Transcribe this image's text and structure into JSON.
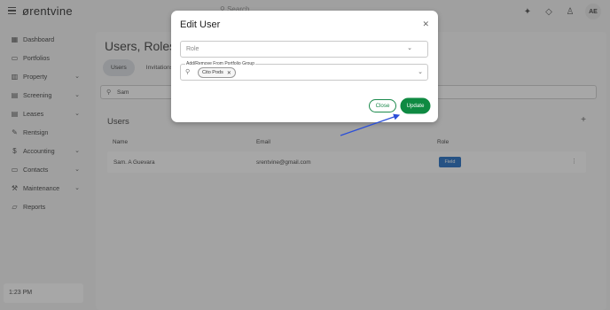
{
  "app": {
    "logo": "ørentvine",
    "search_placeholder": "Search ..."
  },
  "topbar": {
    "avatar_initials": "AE",
    "icons": [
      "sparkle-icon",
      "bell-icon",
      "person-icon"
    ]
  },
  "sidebar": {
    "items": [
      {
        "label": "Dashboard",
        "icon": "grid-icon",
        "has_chevron": false
      },
      {
        "label": "Portfolios",
        "icon": "folder-icon",
        "has_chevron": false
      },
      {
        "label": "Property",
        "icon": "building-icon",
        "has_chevron": true
      },
      {
        "label": "Screening",
        "icon": "screening-icon",
        "has_chevron": true
      },
      {
        "label": "Leases",
        "icon": "document-icon",
        "has_chevron": true
      },
      {
        "label": "Rentsign",
        "icon": "pen-icon",
        "has_chevron": false
      },
      {
        "label": "Accounting",
        "icon": "dollar-icon",
        "has_chevron": true
      },
      {
        "label": "Contacts",
        "icon": "contacts-icon",
        "has_chevron": true
      },
      {
        "label": "Maintenance",
        "icon": "wrench-icon",
        "has_chevron": true
      },
      {
        "label": "Reports",
        "icon": "reports-icon",
        "has_chevron": false
      }
    ],
    "clock": "1:23 PM"
  },
  "main": {
    "title": "Users, Roles",
    "tabs": [
      {
        "label": "Users",
        "active": true
      },
      {
        "label": "Invitations",
        "active": false
      }
    ],
    "search_value": "Sam",
    "users_heading": "Users",
    "columns": [
      "Name",
      "Email",
      "Role"
    ],
    "rows": [
      {
        "name": "Sam. A Guevara",
        "email": "srentvine@gmail.com",
        "role": "Field"
      }
    ]
  },
  "modal": {
    "title": "Edit User",
    "role_placeholder": "Role",
    "group_label": "Add/Remove From Portfolio Group",
    "group_chips": [
      "Cito Pods"
    ],
    "close_label": "Close",
    "update_label": "Update"
  },
  "colors": {
    "primary_green": "#0f8a42",
    "role_blue": "#1565c0",
    "arrow_blue": "#2b4fd8"
  }
}
